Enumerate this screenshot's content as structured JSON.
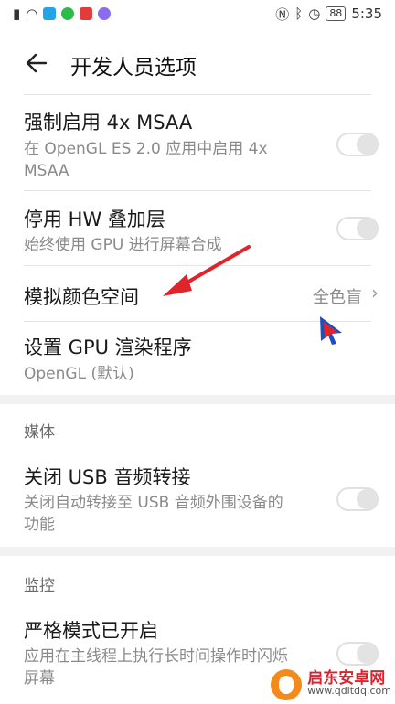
{
  "status_bar": {
    "time": "5:35",
    "battery": "88"
  },
  "header": {
    "title": "开发人员选项"
  },
  "rows": [
    {
      "title": "强制启用 4x MSAA",
      "subtitle": "在 OpenGL ES 2.0 应用中启用 4x MSAA",
      "toggle_on": false
    },
    {
      "title": "停用 HW 叠加层",
      "subtitle": "始终使用 GPU 进行屏幕合成",
      "toggle_on": false
    },
    {
      "title": "模拟颜色空间",
      "value": "全色盲"
    },
    {
      "title": "设置 GPU 渲染程序",
      "subtitle": "OpenGL (默认)"
    }
  ],
  "sections": [
    {
      "header": "媒体",
      "items": [
        {
          "title": "关闭 USB 音频转接",
          "subtitle": "关闭自动转接至 USB 音频外围设备的功能",
          "toggle_on": false
        }
      ]
    },
    {
      "header": "监控",
      "items": [
        {
          "title": "严格模式已开启",
          "subtitle": "应用在主线程上执行长时间操作时闪烁屏幕",
          "toggle_on": false
        }
      ]
    }
  ],
  "watermark": {
    "name": "启东安卓网",
    "url": "www.qdltdq.com"
  },
  "colors": {
    "annotation_arrow": "#e0242b",
    "cursor": "#e0242b",
    "watermark_brand": "#e0212b"
  }
}
